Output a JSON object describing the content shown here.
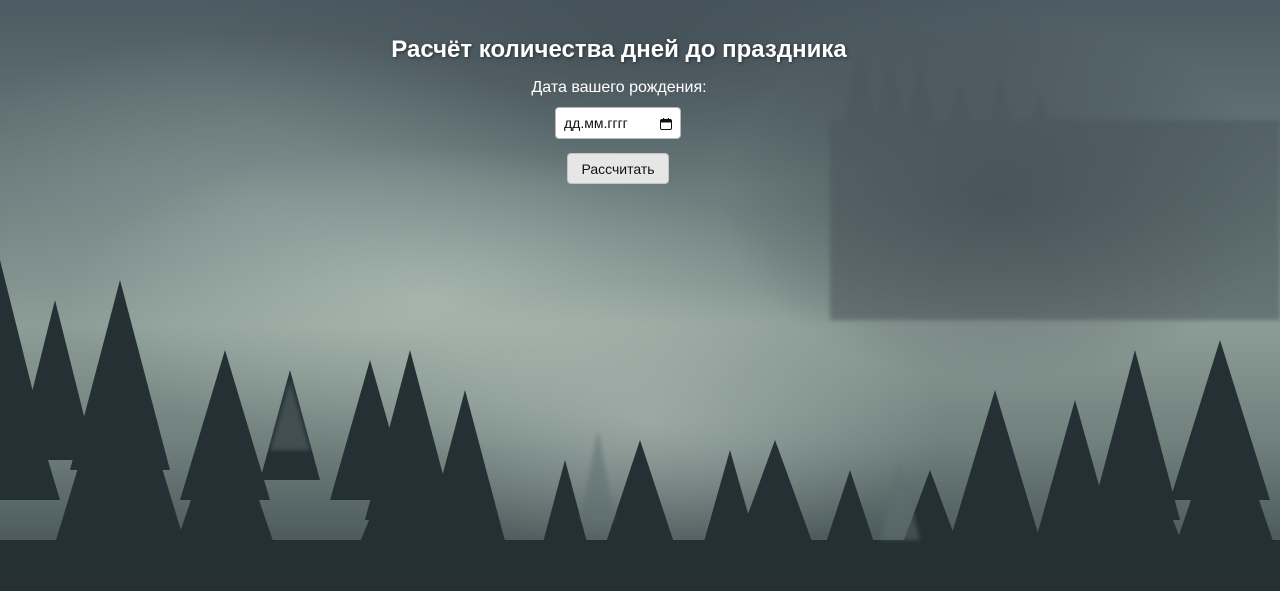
{
  "page": {
    "title": "Расчёт количества дней до праздника"
  },
  "form": {
    "birthdate_label": "Дата вашего рождения:",
    "birthdate_placeholder": "дд.мм.гггг",
    "calculate_button": "Рассчитать"
  },
  "colors": {
    "text": "#ffffff",
    "button_bg": "#e6e6e6",
    "input_bg": "#ffffff"
  },
  "icons": {
    "date_picker": "calendar-icon"
  }
}
